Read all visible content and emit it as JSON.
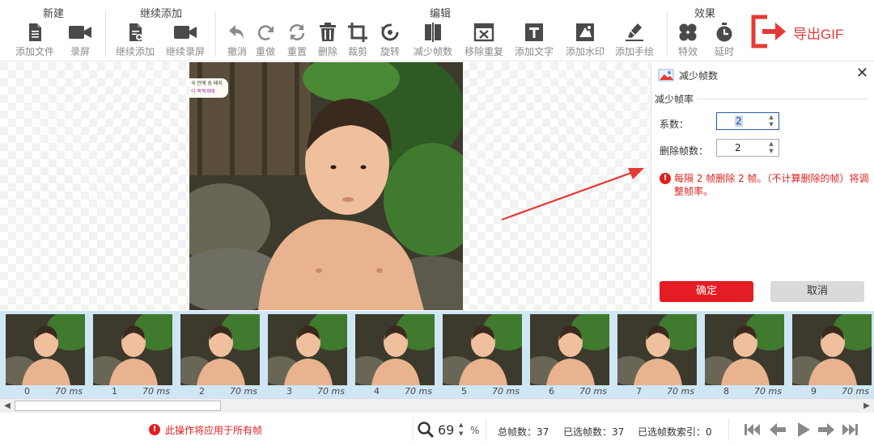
{
  "toolbar": {
    "groups": {
      "new": "新建",
      "continue_add": "继续添加",
      "edit": "编辑",
      "effects": "效果"
    },
    "tools": {
      "add_file": "添加文件",
      "record": "录屏",
      "continue_add": "继续添加",
      "continue_record": "继续录屏",
      "undo": "撤消",
      "redo": "重做",
      "reset": "重置",
      "delete": "删除",
      "crop": "裁剪",
      "rotate": "旋转",
      "reduce_frames": "减少帧数",
      "remove_duplicates": "移除重复",
      "add_text": "添加文字",
      "add_watermark": "添加水印",
      "add_handwriting": "添加手绘",
      "effects": "特效",
      "delay": "延时"
    },
    "export": "导出GIF"
  },
  "canvas": {
    "caption_line1": "국 안에 숭 돼지",
    "caption_line2": "이 쭉쭉재배"
  },
  "dialog": {
    "title": "减少帧数",
    "section": "减少帧率",
    "factor_label": "系数：",
    "factor_value": "2",
    "delete_label": "删除帧数：",
    "delete_value": "2",
    "warning": "每隔 2 帧删除 2 帧。（不计算删除的帧）将调整帧率。",
    "ok": "确定",
    "cancel": "取消"
  },
  "filmstrip": {
    "frames": [
      {
        "index": "0",
        "duration": "70 ms"
      },
      {
        "index": "1",
        "duration": "70 ms"
      },
      {
        "index": "2",
        "duration": "70 ms"
      },
      {
        "index": "3",
        "duration": "70 ms"
      },
      {
        "index": "4",
        "duration": "70 ms"
      },
      {
        "index": "5",
        "duration": "70 ms"
      },
      {
        "index": "6",
        "duration": "70 ms"
      },
      {
        "index": "7",
        "duration": "70 ms"
      },
      {
        "index": "8",
        "duration": "70 ms"
      },
      {
        "index": "9",
        "duration": "70 ms"
      }
    ]
  },
  "status": {
    "apply_all": "此操作将应用于所有帧",
    "zoom": "69",
    "zoom_unit": "%",
    "total_frames": "总帧数：37",
    "selected_frames": "已选帧数：37",
    "selected_index": "已选帧数索引：0"
  },
  "colors": {
    "accent_red": "#e51c23",
    "filmstrip_bg": "#cfe6f5",
    "focus_blue": "#2c5aa0"
  }
}
